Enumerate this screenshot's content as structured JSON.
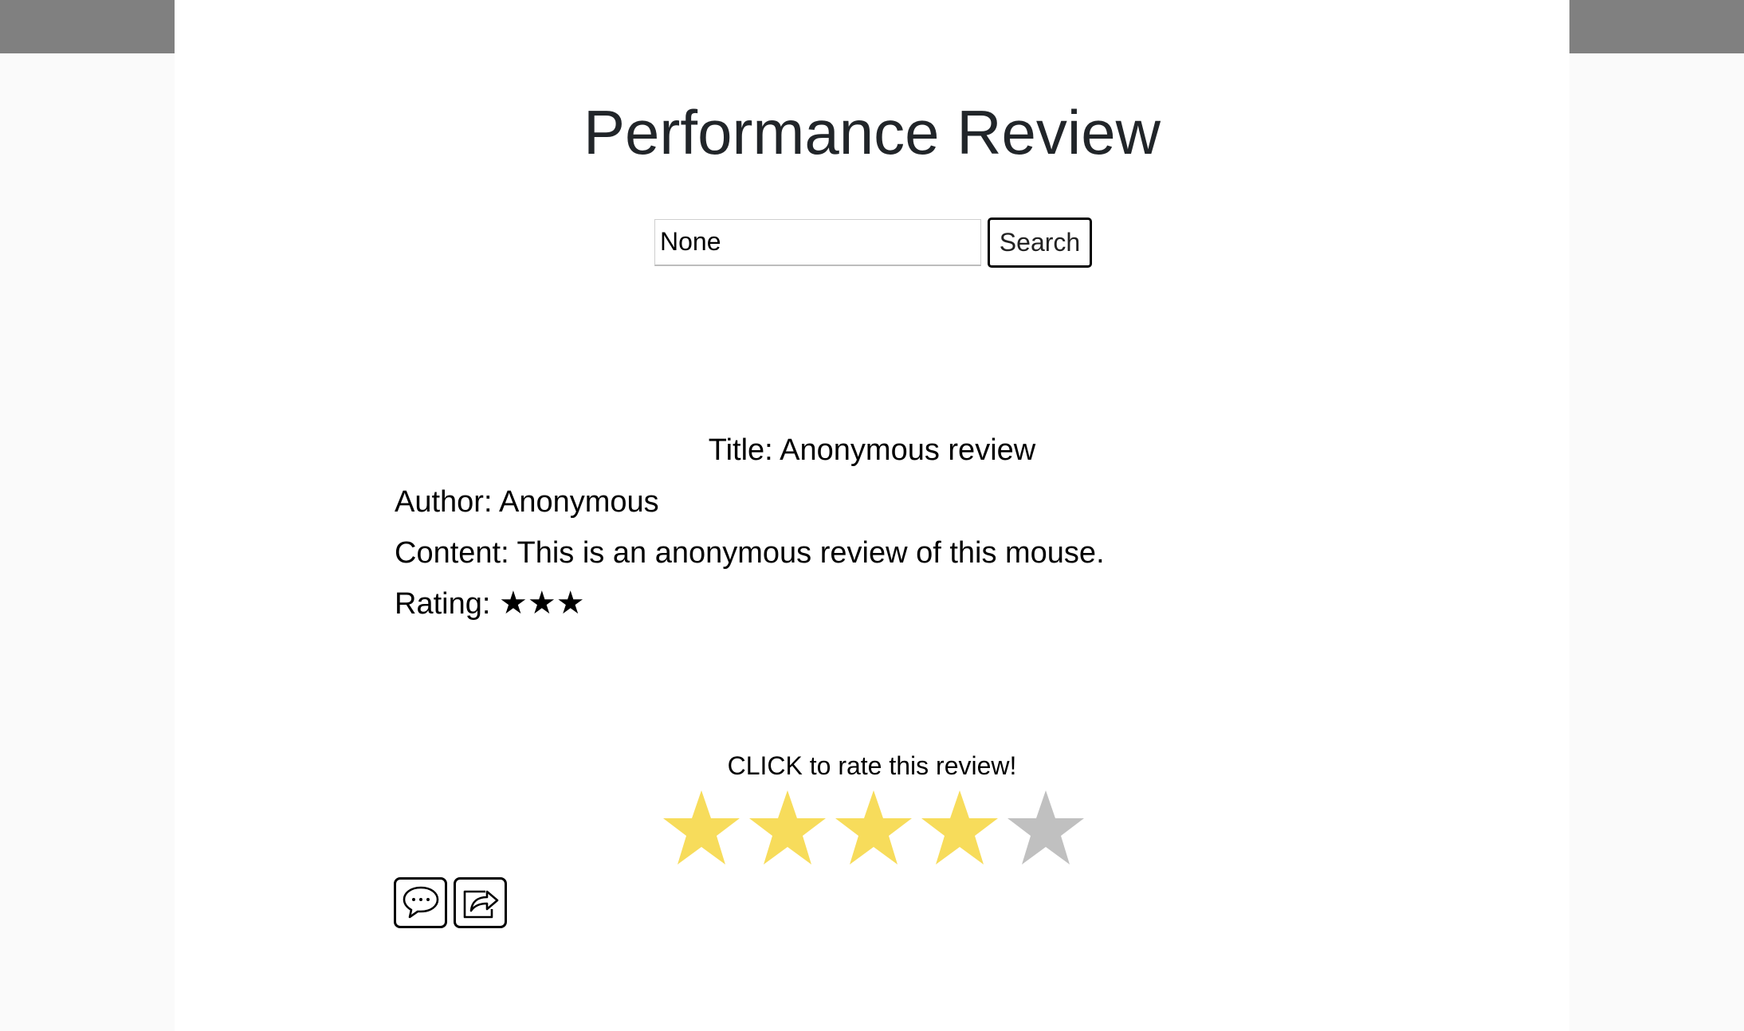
{
  "page": {
    "title": "Performance Review"
  },
  "search": {
    "value": "None",
    "button_label": "Search"
  },
  "review": {
    "title_line": "Title: Anonymous review",
    "author_line": "Author: Anonymous",
    "content_line": "Content: This is an anonymous review of this mouse.",
    "rating_label": "Rating: ",
    "rating_stars": "★★★",
    "rating_value": 3
  },
  "rate": {
    "prompt": "CLICK to rate this review!",
    "selected": 4,
    "max": 5,
    "filled_color": "#f7dc5b",
    "empty_color": "#c0c0c0"
  },
  "actions": {
    "comment_icon": "speech-bubble-icon",
    "share_icon": "share-arrow-icon"
  },
  "colors": {
    "side_bar": "#808080",
    "background": "#fafafa",
    "panel": "#ffffff",
    "title_text": "#212529"
  }
}
